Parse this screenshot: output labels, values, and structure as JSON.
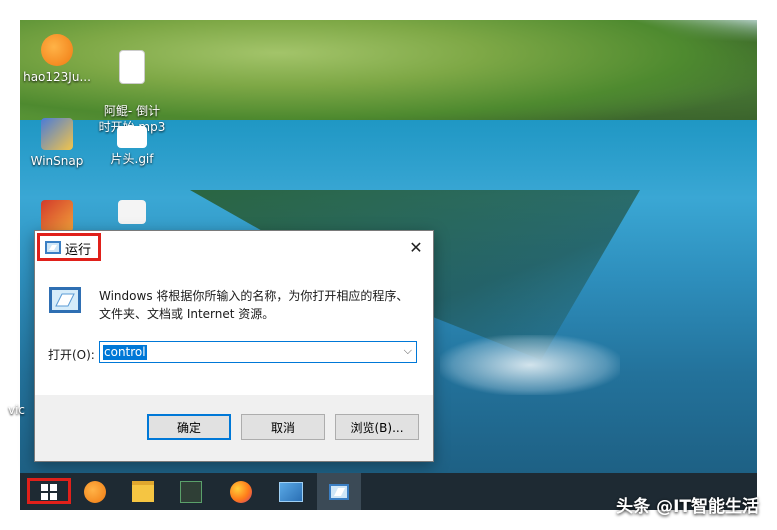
{
  "desktop": {
    "icons": [
      {
        "label": "hao123Ju..."
      },
      {
        "label": "阿鲲-  倒计\n时开始.mp3"
      },
      {
        "label": "WinSnap"
      },
      {
        "label": "片头.gif"
      },
      {
        "label": "vic"
      }
    ]
  },
  "run_dialog": {
    "title": "运行",
    "close": "✕",
    "description": "Windows 将根据你所输入的名称，为你打开相应的程序、文件夹、文档或 Internet 资源。",
    "open_label": "打开(O):",
    "open_value": "control",
    "ok_label": "确定",
    "cancel_label": "取消",
    "browse_label": "浏览(B)..."
  },
  "taskbar": {
    "items": [
      "windows-start",
      "hao123",
      "file-explorer",
      "app-green",
      "firefox",
      "control-panel",
      "run"
    ]
  },
  "watermark": "头条 @IT智能生活",
  "colors": {
    "highlight": "#e0201a",
    "accent": "#0078d7",
    "taskbar": "#1e2a33"
  }
}
